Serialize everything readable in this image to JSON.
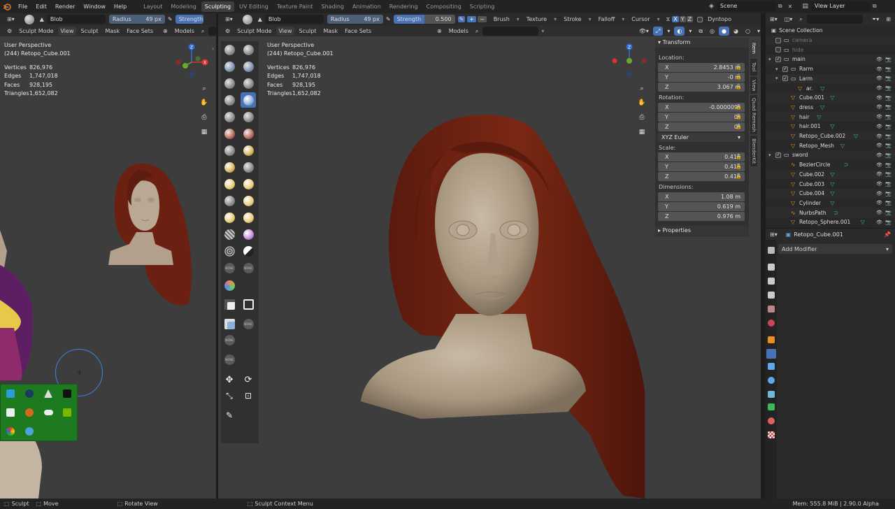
{
  "topbar": {
    "menus": [
      "File",
      "Edit",
      "Render",
      "Window",
      "Help"
    ],
    "workspaces": [
      "Layout",
      "Modeling",
      "Sculpting",
      "UV Editing",
      "Texture Paint",
      "Shading",
      "Animation",
      "Rendering",
      "Compositing",
      "Scripting"
    ],
    "active_workspace": "Sculpting",
    "scene": "Scene",
    "view_layer": "View Layer"
  },
  "left_view": {
    "brush_name": "Blob",
    "radius_label": "Radius",
    "radius_value": "49 px",
    "strength_label": "Strength",
    "mode": "Sculpt Mode",
    "menus": [
      "View",
      "Sculpt",
      "Mask",
      "Face Sets"
    ],
    "models_label": "Models",
    "perspective": "User Perspective",
    "object": "(244) Retopo_Cube.001",
    "stats": [
      {
        "label": "Vertices",
        "value": "826,976"
      },
      {
        "label": "Edges",
        "value": "1,747,018"
      },
      {
        "label": "Faces",
        "value": "928,195"
      },
      {
        "label": "Triangles",
        "value": "1,652,082"
      }
    ]
  },
  "main_view": {
    "brush_name": "Blob",
    "radius_label": "Radius",
    "radius_value": "49 px",
    "strength_label": "Strength",
    "strength_value": "0.500",
    "dropdowns": [
      "Brush",
      "Texture",
      "Stroke",
      "Falloff",
      "Cursor"
    ],
    "axes": [
      "X",
      "Y",
      "Z"
    ],
    "dyntopo": "Dyntopo",
    "mode": "Sculpt Mode",
    "menus": [
      "View",
      "Sculpt",
      "Mask",
      "Face Sets"
    ],
    "models_label": "Models",
    "perspective": "User Perspective",
    "object": "(244) Retopo_Cube.001",
    "stats": [
      {
        "label": "Vertices",
        "value": "826,976"
      },
      {
        "label": "Edges",
        "value": "1,747,018"
      },
      {
        "label": "Faces",
        "value": "928,195"
      },
      {
        "label": "Triangles",
        "value": "1,652,082"
      }
    ],
    "none_label": "NONE"
  },
  "npanel": {
    "transform_title": "Transform",
    "location_label": "Location:",
    "location": [
      {
        "axis": "X",
        "value": "2.8453 m"
      },
      {
        "axis": "Y",
        "value": "-0 m"
      },
      {
        "axis": "Z",
        "value": "3.067 m"
      }
    ],
    "rotation_label": "Rotation:",
    "rotation": [
      {
        "axis": "X",
        "value": "-0.000009°"
      },
      {
        "axis": "Y",
        "value": "0°"
      },
      {
        "axis": "Z",
        "value": "0°"
      }
    ],
    "rotation_mode": "XYZ Euler",
    "scale_label": "Scale:",
    "scale": [
      {
        "axis": "X",
        "value": "0.416"
      },
      {
        "axis": "Y",
        "value": "0.416"
      },
      {
        "axis": "Z",
        "value": "0.416"
      }
    ],
    "dimensions_label": "Dimensions:",
    "dimensions": [
      {
        "axis": "X",
        "value": "1.08 m"
      },
      {
        "axis": "Y",
        "value": "0.619 m"
      },
      {
        "axis": "Z",
        "value": "0.976 m"
      }
    ],
    "properties_title": "Properties",
    "tabs": [
      "Item",
      "Tool",
      "View",
      "Quad Remesh",
      "BlenderKit"
    ]
  },
  "outliner": {
    "root": "Scene Collection",
    "items": [
      {
        "name": "camera",
        "depth": 1,
        "type": "collection",
        "dim": true
      },
      {
        "name": "hide",
        "depth": 1,
        "type": "collection",
        "dim": true
      },
      {
        "name": "main",
        "depth": 1,
        "type": "collection"
      },
      {
        "name": "Rarm",
        "depth": 2,
        "type": "collection"
      },
      {
        "name": "Larm",
        "depth": 2,
        "type": "collection"
      },
      {
        "name": "ar.",
        "depth": 3,
        "type": "mesh"
      },
      {
        "name": "Cube.001",
        "depth": 2,
        "type": "mesh"
      },
      {
        "name": "dress",
        "depth": 2,
        "type": "mesh"
      },
      {
        "name": "hair",
        "depth": 2,
        "type": "mesh"
      },
      {
        "name": "hair.001",
        "depth": 2,
        "type": "mesh"
      },
      {
        "name": "Retopo_Cube.002",
        "depth": 2,
        "type": "mesh"
      },
      {
        "name": "Retopo_Mesh",
        "depth": 2,
        "type": "mesh"
      },
      {
        "name": "sword",
        "depth": 1,
        "type": "collection"
      },
      {
        "name": "BezierCircle",
        "depth": 2,
        "type": "curve"
      },
      {
        "name": "Cube.002",
        "depth": 2,
        "type": "mesh"
      },
      {
        "name": "Cube.003",
        "depth": 2,
        "type": "mesh"
      },
      {
        "name": "Cube.004",
        "depth": 2,
        "type": "mesh"
      },
      {
        "name": "Cylinder",
        "depth": 2,
        "type": "mesh"
      },
      {
        "name": "NurbsPath",
        "depth": 2,
        "type": "curve"
      },
      {
        "name": "Retopo_Sphere.001",
        "depth": 2,
        "type": "mesh"
      }
    ]
  },
  "properties": {
    "object_name": "Retopo_Cube.001",
    "add_modifier": "Add Modifier"
  },
  "status": {
    "sculpt": "Sculpt",
    "move": "Move",
    "rotate": "Rotate View",
    "context": "Sculpt Context Menu",
    "memory": "Mem: 555.8 MiB | 2.90.0 Alpha"
  },
  "colors": {
    "accent": "#4772b3",
    "hair": "#6b2012",
    "skin": "#b8a894",
    "viewport_bg": "#3d3d3d",
    "tray_bg": "#1e7a1e"
  }
}
